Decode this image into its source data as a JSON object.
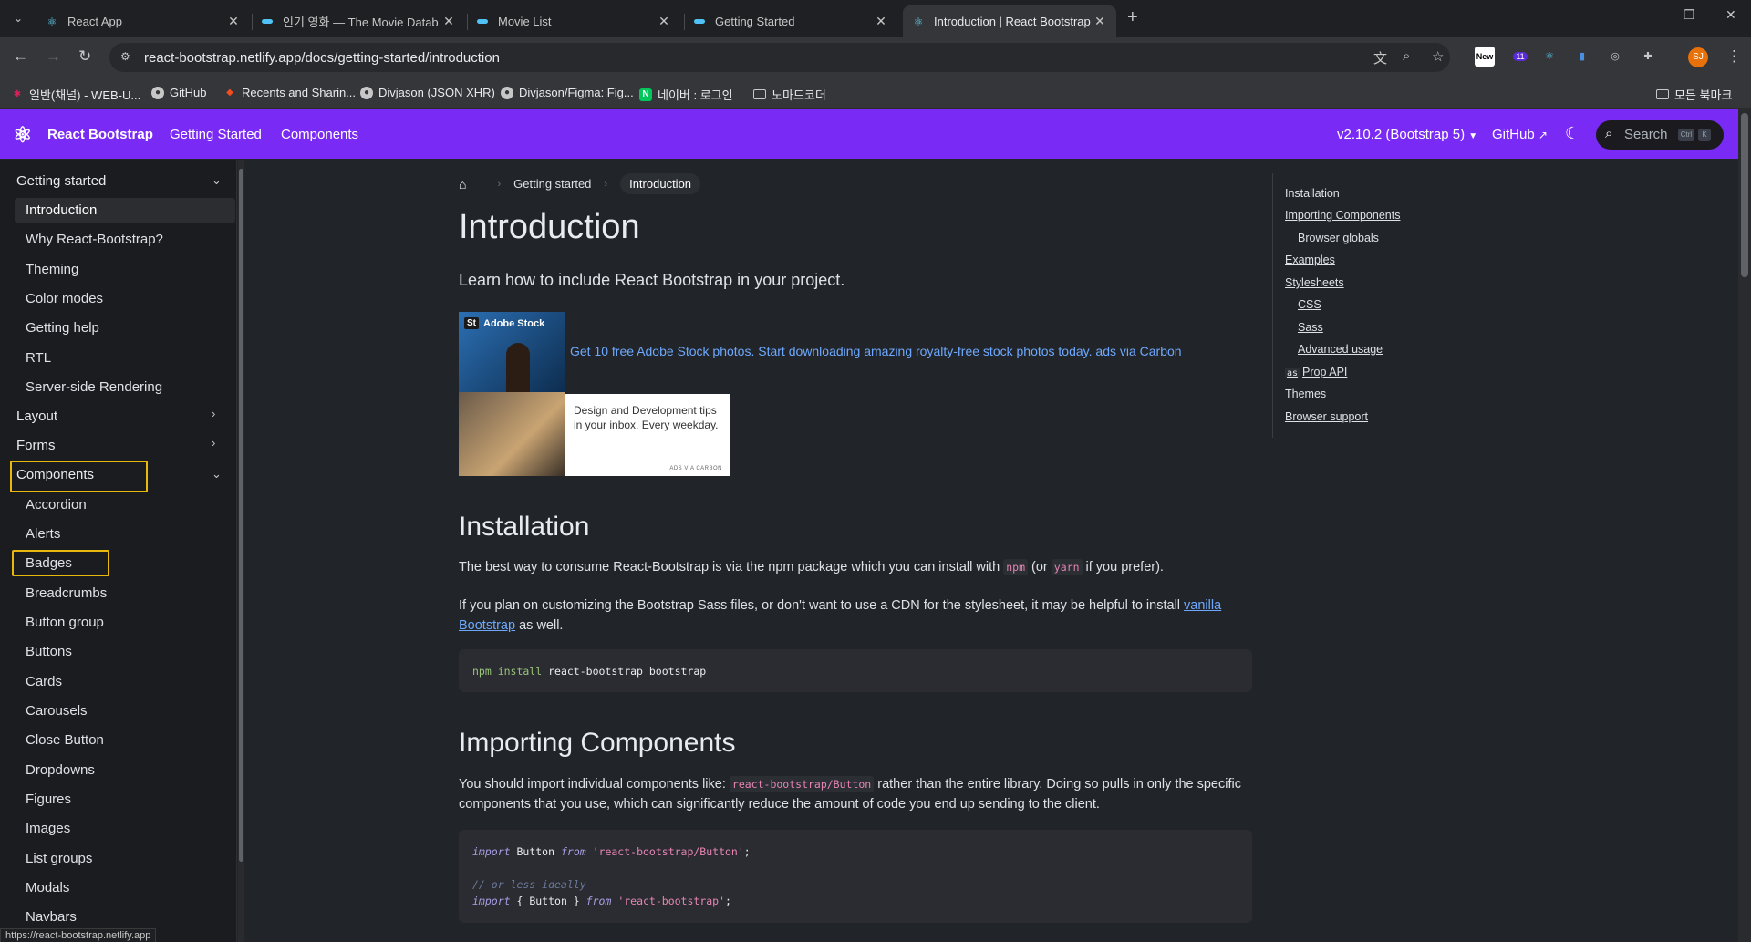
{
  "browser": {
    "tabs": [
      {
        "title": "React App",
        "icon": "react-icon"
      },
      {
        "title": "인기 영화 — The Movie Datab",
        "icon": "tmdb-icon"
      },
      {
        "title": "Movie List",
        "icon": "tmdb-icon"
      },
      {
        "title": "Getting Started",
        "icon": "tmdb-icon"
      },
      {
        "title": "Introduction | React Bootstrap",
        "icon": "react-bootstrap-icon",
        "active": true
      }
    ],
    "url": "react-bootstrap.netlify.app/docs/getting-started/introduction",
    "bookmarks": [
      "일반(채널) - WEB-U...",
      "GitHub",
      "Recents and Sharin...",
      "Divjason (JSON XHR)",
      "Divjason/Figma: Fig...",
      "네이버 : 로그인",
      "노마드코더"
    ],
    "all_bookmarks": "모든 북마크",
    "ext_new_label": "New",
    "ext_badge": "11",
    "avatar_initials": "SJ",
    "status_url": "https://react-bootstrap.netlify.app"
  },
  "site": {
    "brand": "React Bootstrap",
    "nav": [
      "Getting Started",
      "Components"
    ],
    "version": "v2.10.2 (Bootstrap 5)",
    "github": "GitHub",
    "search_placeholder": "Search",
    "kbd_ctrl": "Ctrl",
    "kbd_k": "K",
    "accent_color": "#7a2af5"
  },
  "sidebar": {
    "groups": [
      {
        "label": "Getting started",
        "expanded": true
      },
      {
        "label": "Layout",
        "expanded": false
      },
      {
        "label": "Forms",
        "expanded": false
      },
      {
        "label": "Components",
        "expanded": true
      }
    ],
    "getting_started_items": [
      "Introduction",
      "Why React-Bootstrap?",
      "Theming",
      "Color modes",
      "Getting help",
      "RTL",
      "Server-side Rendering"
    ],
    "component_items": [
      "Accordion",
      "Alerts",
      "Badges",
      "Breadcrumbs",
      "Button group",
      "Buttons",
      "Cards",
      "Carousels",
      "Close Button",
      "Dropdowns",
      "Figures",
      "Images",
      "List groups",
      "Modals",
      "Navbars"
    ]
  },
  "breadcrumb": {
    "parent": "Getting started",
    "current": "Introduction"
  },
  "page": {
    "title": "Introduction",
    "lead": "Learn how to include React Bootstrap in your project.",
    "ad": {
      "brand": "Adobe Stock",
      "brand_mark": "St",
      "link": "Get 10 free Adobe Stock photos. Start downloading amazing royalty-free stock photos today. ads via Carbon",
      "card_text": "Design and Development tips in your inbox. Every weekday.",
      "via": "ADS VIA CARBON"
    },
    "installation": {
      "heading": "Installation",
      "p1_a": "The best way to consume React-Bootstrap is via the npm package which you can install with",
      "p1_npm": "npm",
      "p1_b": "(or",
      "p1_yarn": "yarn",
      "p1_c": "if you prefer).",
      "p2_a": "If you plan on customizing the Bootstrap Sass files, or don't want to use a CDN for the stylesheet, it may be helpful to install",
      "p2_link": "vanilla Bootstrap",
      "p2_b": "as well.",
      "code_cmd": "npm install",
      "code_args": "react-bootstrap bootstrap"
    },
    "importing": {
      "heading": "Importing Components",
      "p_a": "You should import individual components like:",
      "p_code": "react-bootstrap/Button",
      "p_b": "rather than the entire library. Doing so pulls in only the specific components that you use, which can significantly reduce the amount of code you end up sending to the client.",
      "code": {
        "import": "import",
        "from": "from",
        "l1_name": "Button",
        "l1_src": "'react-bootstrap/Button'",
        "comment": "// or less ideally",
        "l3_name": "{ Button }",
        "l3_src": "'react-bootstrap'",
        "semicolon": ";"
      }
    }
  },
  "toc": [
    {
      "label": "Installation",
      "indent": 0,
      "link": false
    },
    {
      "label": "Importing Components",
      "indent": 0,
      "link": true
    },
    {
      "label": "Browser globals",
      "indent": 1,
      "link": true
    },
    {
      "label": "Examples",
      "indent": 0,
      "link": true
    },
    {
      "label": "Stylesheets",
      "indent": 0,
      "link": true
    },
    {
      "label": "CSS",
      "indent": 1,
      "link": true
    },
    {
      "label": "Sass",
      "indent": 1,
      "link": true
    },
    {
      "label": "Advanced usage",
      "indent": 1,
      "link": true
    },
    {
      "label": "Prop API",
      "indent": 0,
      "link": true,
      "badge": "as"
    },
    {
      "label": "Themes",
      "indent": 0,
      "link": true
    },
    {
      "label": "Browser support",
      "indent": 0,
      "link": true
    }
  ]
}
